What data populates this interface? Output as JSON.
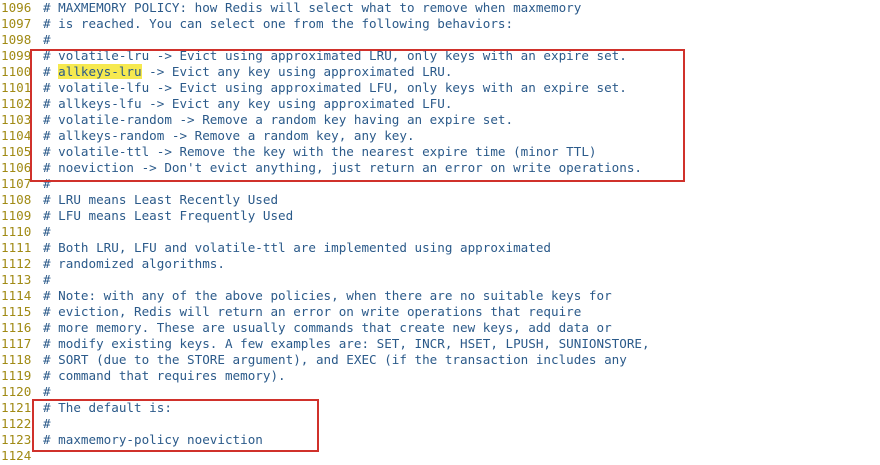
{
  "lines": [
    {
      "num": "1096",
      "text": "# MAXMEMORY POLICY: how Redis will select what to remove when maxmemory"
    },
    {
      "num": "1097",
      "text": "# is reached. You can select one from the following behaviors:"
    },
    {
      "num": "1098",
      "text": "#"
    },
    {
      "num": "1099",
      "text": "# volatile-lru -> Evict using approximated LRU, only keys with an expire set."
    },
    {
      "num": "1100",
      "text": "allkeys-lru",
      "prefix": "# ",
      "suffix": " -> Evict any key using approximated LRU."
    },
    {
      "num": "1101",
      "text": "# volatile-lfu -> Evict using approximated LFU, only keys with an expire set."
    },
    {
      "num": "1102",
      "text": "# allkeys-lfu -> Evict any key using approximated LFU."
    },
    {
      "num": "1103",
      "text": "# volatile-random -> Remove a random key having an expire set."
    },
    {
      "num": "1104",
      "text": "# allkeys-random -> Remove a random key, any key."
    },
    {
      "num": "1105",
      "text": "# volatile-ttl -> Remove the key with the nearest expire time (minor TTL)"
    },
    {
      "num": "1106",
      "text": "# noeviction -> Don't evict anything, just return an error on write operations."
    },
    {
      "num": "1107",
      "text": "#"
    },
    {
      "num": "1108",
      "text": "# LRU means Least Recently Used"
    },
    {
      "num": "1109",
      "text": "# LFU means Least Frequently Used"
    },
    {
      "num": "1110",
      "text": "#"
    },
    {
      "num": "1111",
      "text": "# Both LRU, LFU and volatile-ttl are implemented using approximated"
    },
    {
      "num": "1112",
      "text": "# randomized algorithms."
    },
    {
      "num": "1113",
      "text": "#"
    },
    {
      "num": "1114",
      "text": "# Note: with any of the above policies, when there are no suitable keys for"
    },
    {
      "num": "1115",
      "text": "# eviction, Redis will return an error on write operations that require"
    },
    {
      "num": "1116",
      "text": "# more memory. These are usually commands that create new keys, add data or"
    },
    {
      "num": "1117",
      "text": "# modify existing keys. A few examples are: SET, INCR, HSET, LPUSH, SUNIONSTORE,"
    },
    {
      "num": "1118",
      "text": "# SORT (due to the STORE argument), and EXEC (if the transaction includes any"
    },
    {
      "num": "1119",
      "text": "# command that requires memory)."
    },
    {
      "num": "1120",
      "text": "#"
    },
    {
      "num": "1121",
      "text": "# The default is:"
    },
    {
      "num": "1122",
      "text": "#"
    },
    {
      "num": "1123",
      "text": "# maxmemory-policy noeviction"
    },
    {
      "num": "1124",
      "text": ""
    }
  ]
}
